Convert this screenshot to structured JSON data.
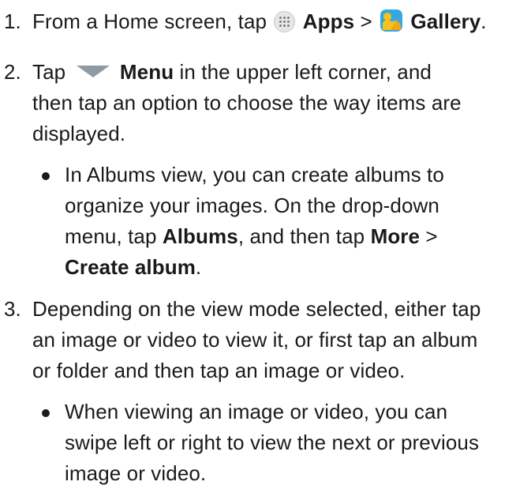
{
  "steps": [
    {
      "number": "1.",
      "parts": {
        "a": "From a Home screen, tap",
        "apps": "Apps",
        "sep": ">",
        "gallery": "Gallery",
        "end": "."
      }
    },
    {
      "number": "2.",
      "parts": {
        "a": "Tap",
        "menu": "Menu",
        "b": "in the upper left corner, and",
        "line2": "then tap an option to choose the way items are",
        "line3": "displayed."
      },
      "bullet": {
        "l1": "In Albums view, you can create albums to",
        "l2": "organize your images. On the drop-down",
        "l3a": "menu, tap",
        "albums": "Albums",
        "l3b": ", and then tap",
        "more": "More",
        "l3c": ">",
        "create": "Create album",
        "l4end": "."
      }
    },
    {
      "number": "3.",
      "parts": {
        "line1": "Depending on the view mode selected, either tap",
        "line2": "an image or video to view it, or first tap an album",
        "line3": "or folder and then tap an image or video."
      },
      "bullet": {
        "l1": "When viewing an image or video, you can",
        "l2": "swipe left or right to view the next or previous",
        "l3": "image or video."
      }
    }
  ],
  "icons": {
    "apps": "apps-grid-icon",
    "gallery": "gallery-icon",
    "menu": "menu-dropdown-triangle-icon"
  },
  "colors": {
    "text": "#1a1a1a",
    "gallery_sky": "#35a8e0",
    "gallery_sun": "#f7c21b",
    "menu_triangle": "#8f9aa3"
  }
}
